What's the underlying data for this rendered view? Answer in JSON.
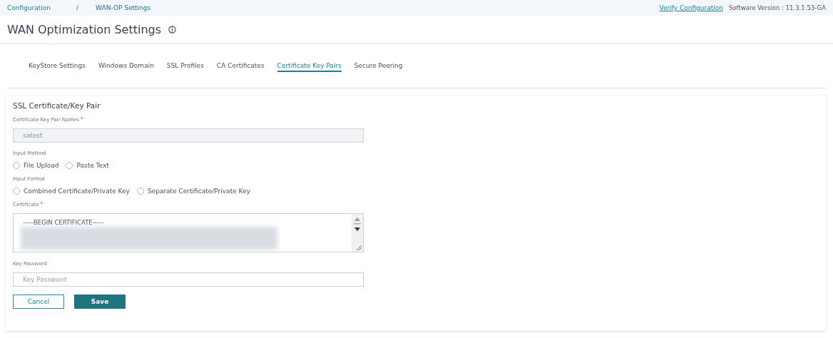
{
  "breadcrumb": [
    {
      "label": "Configuration"
    },
    {
      "label": "WAN-OP Settings"
    }
  ],
  "breadcrumb_separator": "/",
  "header_links": {
    "verify": "Verify Configuration",
    "version": "Software Version :  11.3.1.53-GA"
  },
  "page_title": "WAN Optimization Settings",
  "tabs": [
    {
      "label": "KeyStore Settings",
      "selected": false
    },
    {
      "label": "Windows Domain",
      "selected": false
    },
    {
      "label": "SSL Profiles",
      "selected": false
    },
    {
      "label": "CA Certificates",
      "selected": false
    },
    {
      "label": "Certificate Key Pairs",
      "selected": true
    },
    {
      "label": "Secure Peering",
      "selected": false
    }
  ],
  "form": {
    "title": "SSL Certificate/Key Pair",
    "name_field": {
      "label": "Certificate Key Pair Names",
      "required_mark": "*",
      "value": "satest",
      "disabled": true
    },
    "input_method": {
      "label": "Input Method",
      "options": [
        {
          "label": "File Upload",
          "selected": false
        },
        {
          "label": "Paste Text",
          "selected": false
        }
      ]
    },
    "input_format": {
      "label": "Input Format",
      "options": [
        {
          "label": "Combined Certificate/Private Key",
          "selected": false
        },
        {
          "label": "Separate Certificate/Private Key",
          "selected": false
        }
      ]
    },
    "certificate": {
      "label": "Certificate",
      "required_mark": "*",
      "value": "-----BEGIN CERTIFICATE-----"
    },
    "key_password": {
      "label": "Key Password",
      "placeholder": "Key Password"
    },
    "buttons": [
      {
        "label": "Cancel",
        "kind": "secondary"
      },
      {
        "label": "Save",
        "kind": "primary"
      }
    ]
  }
}
